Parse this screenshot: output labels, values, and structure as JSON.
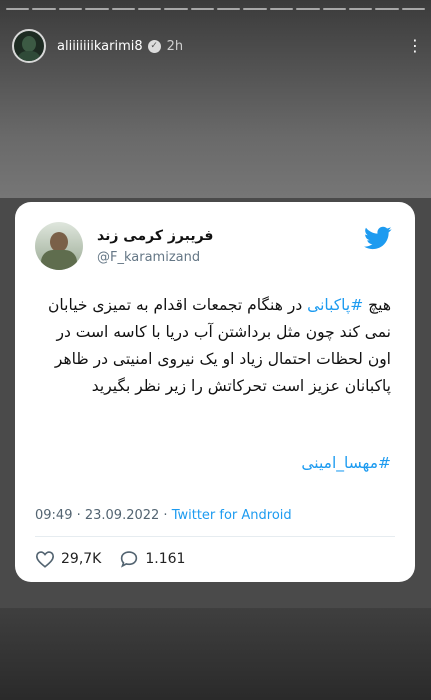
{
  "story": {
    "username": "aliiiiiiikarimi8",
    "time": "2h",
    "segment_count": 16
  },
  "tweet": {
    "name": "فریبرز کرمی زند",
    "handle": "@F_karamizand",
    "text_before": "هیچ ",
    "hashtag_inline": "#پاکبانی",
    "text_after": " در هنگام تجمعات اقدام به تمیزی خیابان نمی کند چون مثل برداشتن آب دریا با کاسه است در اون لحظات احتمال زیاد او یک نیروی امنیتی در ظاهر پاکبانان عزیز است تحرکاتش را زیر نظر بگیرید",
    "hashtag_footer": "#مهسا_امینی",
    "timestamp": "09:49 · 23.09.2022 · ",
    "source": "Twitter for Android",
    "likes": "29,7K",
    "replies": "1.161"
  },
  "colors": {
    "twitter_blue": "#1d9bf0"
  },
  "icons": [
    "more-options-icon",
    "verified-badge-icon",
    "twitter-bird-icon",
    "heart-icon",
    "reply-bubble-icon"
  ]
}
